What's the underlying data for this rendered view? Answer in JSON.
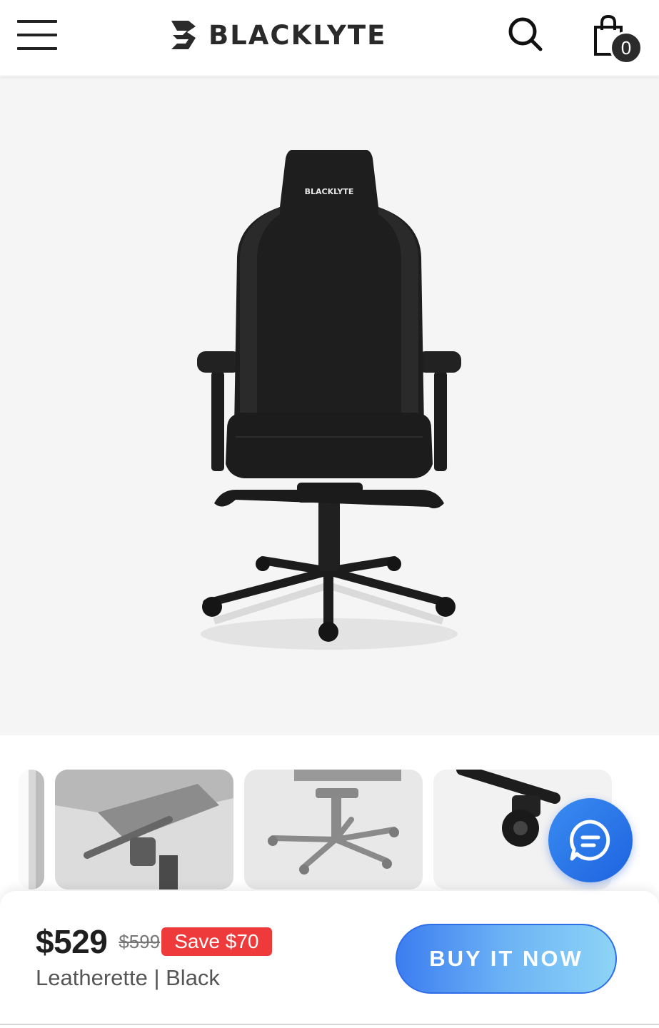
{
  "header": {
    "brand": "BLACKLYTE",
    "cart_count": "0",
    "icons": {
      "menu": "hamburger-menu-icon",
      "logo": "blacklyte-logo-icon",
      "search": "search-icon",
      "cart": "shopping-bag-icon"
    }
  },
  "hero": {
    "chair_logo_text": "BLACKLYTE",
    "background": "#f5f5f5"
  },
  "thumbnails": [
    {
      "subject": "chair side edge"
    },
    {
      "subject": "seat tilt mechanism"
    },
    {
      "subject": "chair base and wheels"
    },
    {
      "subject": "caster wheel close-up"
    }
  ],
  "chat": {
    "icon": "chat-bubble-icon"
  },
  "product": {
    "price": "$529",
    "old_price": "$599",
    "save_label": "Save $70",
    "variant": "Leatherette | Black",
    "buy_label": "BUY IT NOW"
  },
  "colors": {
    "accent_blue": "#2f6ee8",
    "sale_red": "#ee3a3a",
    "text_dark": "#1e1e1e"
  }
}
